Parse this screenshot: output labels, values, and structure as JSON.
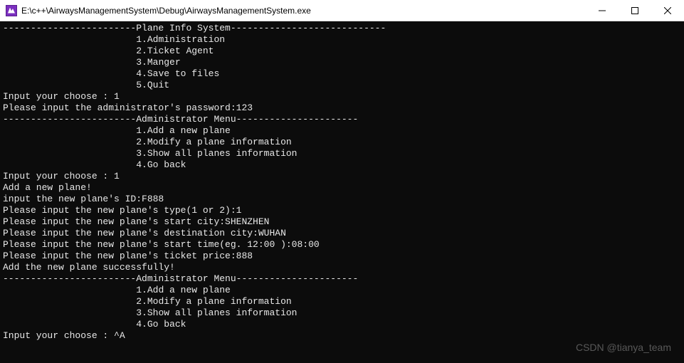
{
  "window": {
    "title": "E:\\c++\\AirwaysManagementSystem\\Debug\\AirwaysManagementSystem.exe"
  },
  "console": {
    "main_menu": {
      "indent": "                        ",
      "header": "------------------------Plane Info System----------------------------",
      "items": [
        "1.Administration",
        "2.Ticket Agent",
        "3.Manger",
        "4.Save to files",
        "5.Quit"
      ]
    },
    "input_choose_1": "Input your choose : 1",
    "password_line": "Please input the administrator's password:123",
    "admin_menu": {
      "indent": "                        ",
      "header": "------------------------Administrator Menu----------------------",
      "items": [
        "1.Add a new plane",
        "2.Modify a plane information",
        "3.Show all planes information",
        "4.Go back"
      ]
    },
    "input_choose_2": "Input your choose : 1",
    "add_plane_msg": "Add a new plane!",
    "plane_id_line": "input the new plane's ID:F888",
    "plane_type_line": "Please input the new plane's type(1 or 2):1",
    "start_city_line": "Please input the new plane's start city:SHENZHEN",
    "dest_city_line": "Please input the new plane's destination city:WUHAN",
    "start_time_line": "Please input the new plane's start time(eg. 12:00 ):08:00",
    "ticket_price_line": "Please input the new plane's ticket price:888",
    "success_msg": "Add the new plane successfully!",
    "input_choose_3": "Input your choose : ^A"
  },
  "watermark": "CSDN @tianya_team"
}
